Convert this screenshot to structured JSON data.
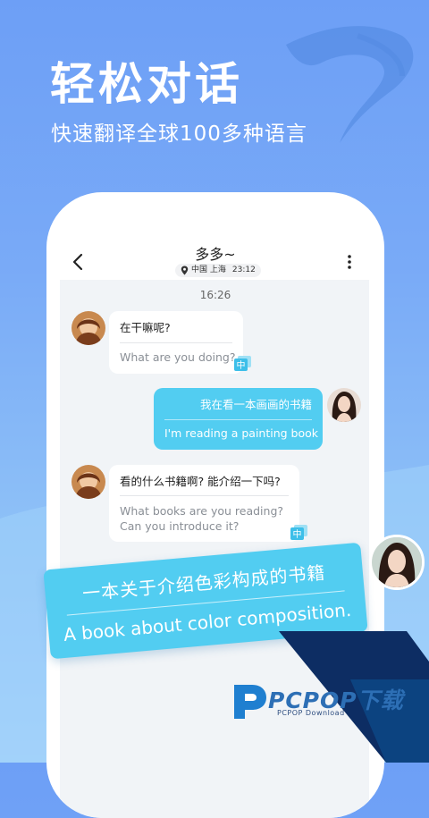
{
  "promo": {
    "headline": "轻松对话",
    "subline": "快速翻译全球100多种语言"
  },
  "header": {
    "title": "多多~",
    "location": "中国 上海",
    "local_time": "23:12"
  },
  "chat": {
    "timestamp": "16:26",
    "messages": [
      {
        "side": "in",
        "original": "在干嘛呢?",
        "translation": "What are you doing?"
      },
      {
        "side": "out",
        "original": "我在看一本画画的书籍",
        "translation": "I'm reading a painting book"
      },
      {
        "side": "in",
        "original": "看的什么书籍啊? 能介绍一下吗?",
        "translation_line1": "What books are you reading?",
        "translation_line2": "Can you introduce it?"
      }
    ],
    "badge_label": "中"
  },
  "highlight": {
    "original": "一本关于介绍色彩构成的书籍",
    "translation": "A book about color composition."
  },
  "watermark": {
    "name": "PCPOP下载",
    "sub": "PCPOP Download"
  },
  "colors": {
    "background": "#79aaf7",
    "accent": "#52cdf1",
    "watermark_navy": "#0d2d63"
  }
}
